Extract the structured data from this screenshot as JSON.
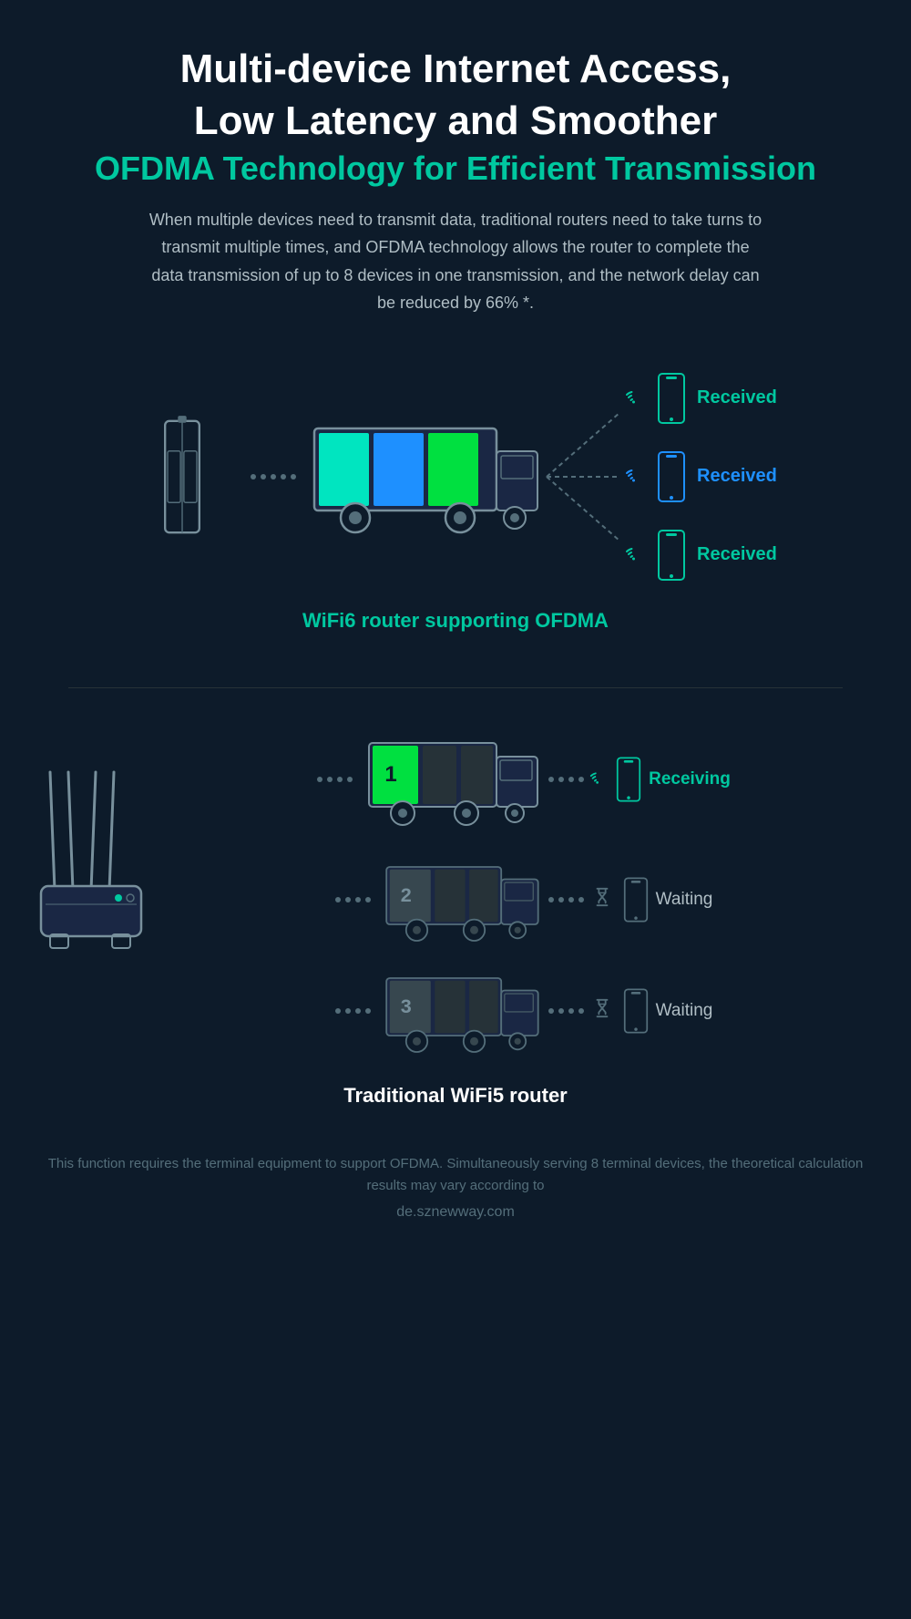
{
  "page": {
    "background": "#0d1b2a"
  },
  "header": {
    "title_line1": "Multi-device Internet Access,",
    "title_line2": "Low Latency and Smoother",
    "title_line3": "OFDMA Technology for Efficient Transmission",
    "description": "When multiple devices need to transmit data, traditional routers need to take turns to transmit multiple times, and OFDMA technology allows the router to complete the data transmission of up to 8 devices in one transmission, and the network delay can be reduced by 66% *."
  },
  "wifi6_section": {
    "caption": "WiFi6 router supporting OFDMA",
    "devices": [
      {
        "label": "Received",
        "color": "green"
      },
      {
        "label": "Received",
        "color": "blue"
      },
      {
        "label": "Received",
        "color": "green"
      }
    ]
  },
  "wifi5_section": {
    "caption": "Traditional WiFi5 router",
    "rows": [
      {
        "number": "1",
        "status": "Receiving",
        "color": "green",
        "active": true
      },
      {
        "number": "2",
        "status": "Waiting",
        "color": "gray",
        "active": false
      },
      {
        "number": "3",
        "status": "Waiting",
        "color": "gray",
        "active": false
      }
    ]
  },
  "footer": {
    "note": "This function requires the terminal equipment to support OFDMA. Simultaneously serving 8 terminal devices, the theoretical calculation results may vary according to",
    "watermark": "de.sznewway.com"
  }
}
